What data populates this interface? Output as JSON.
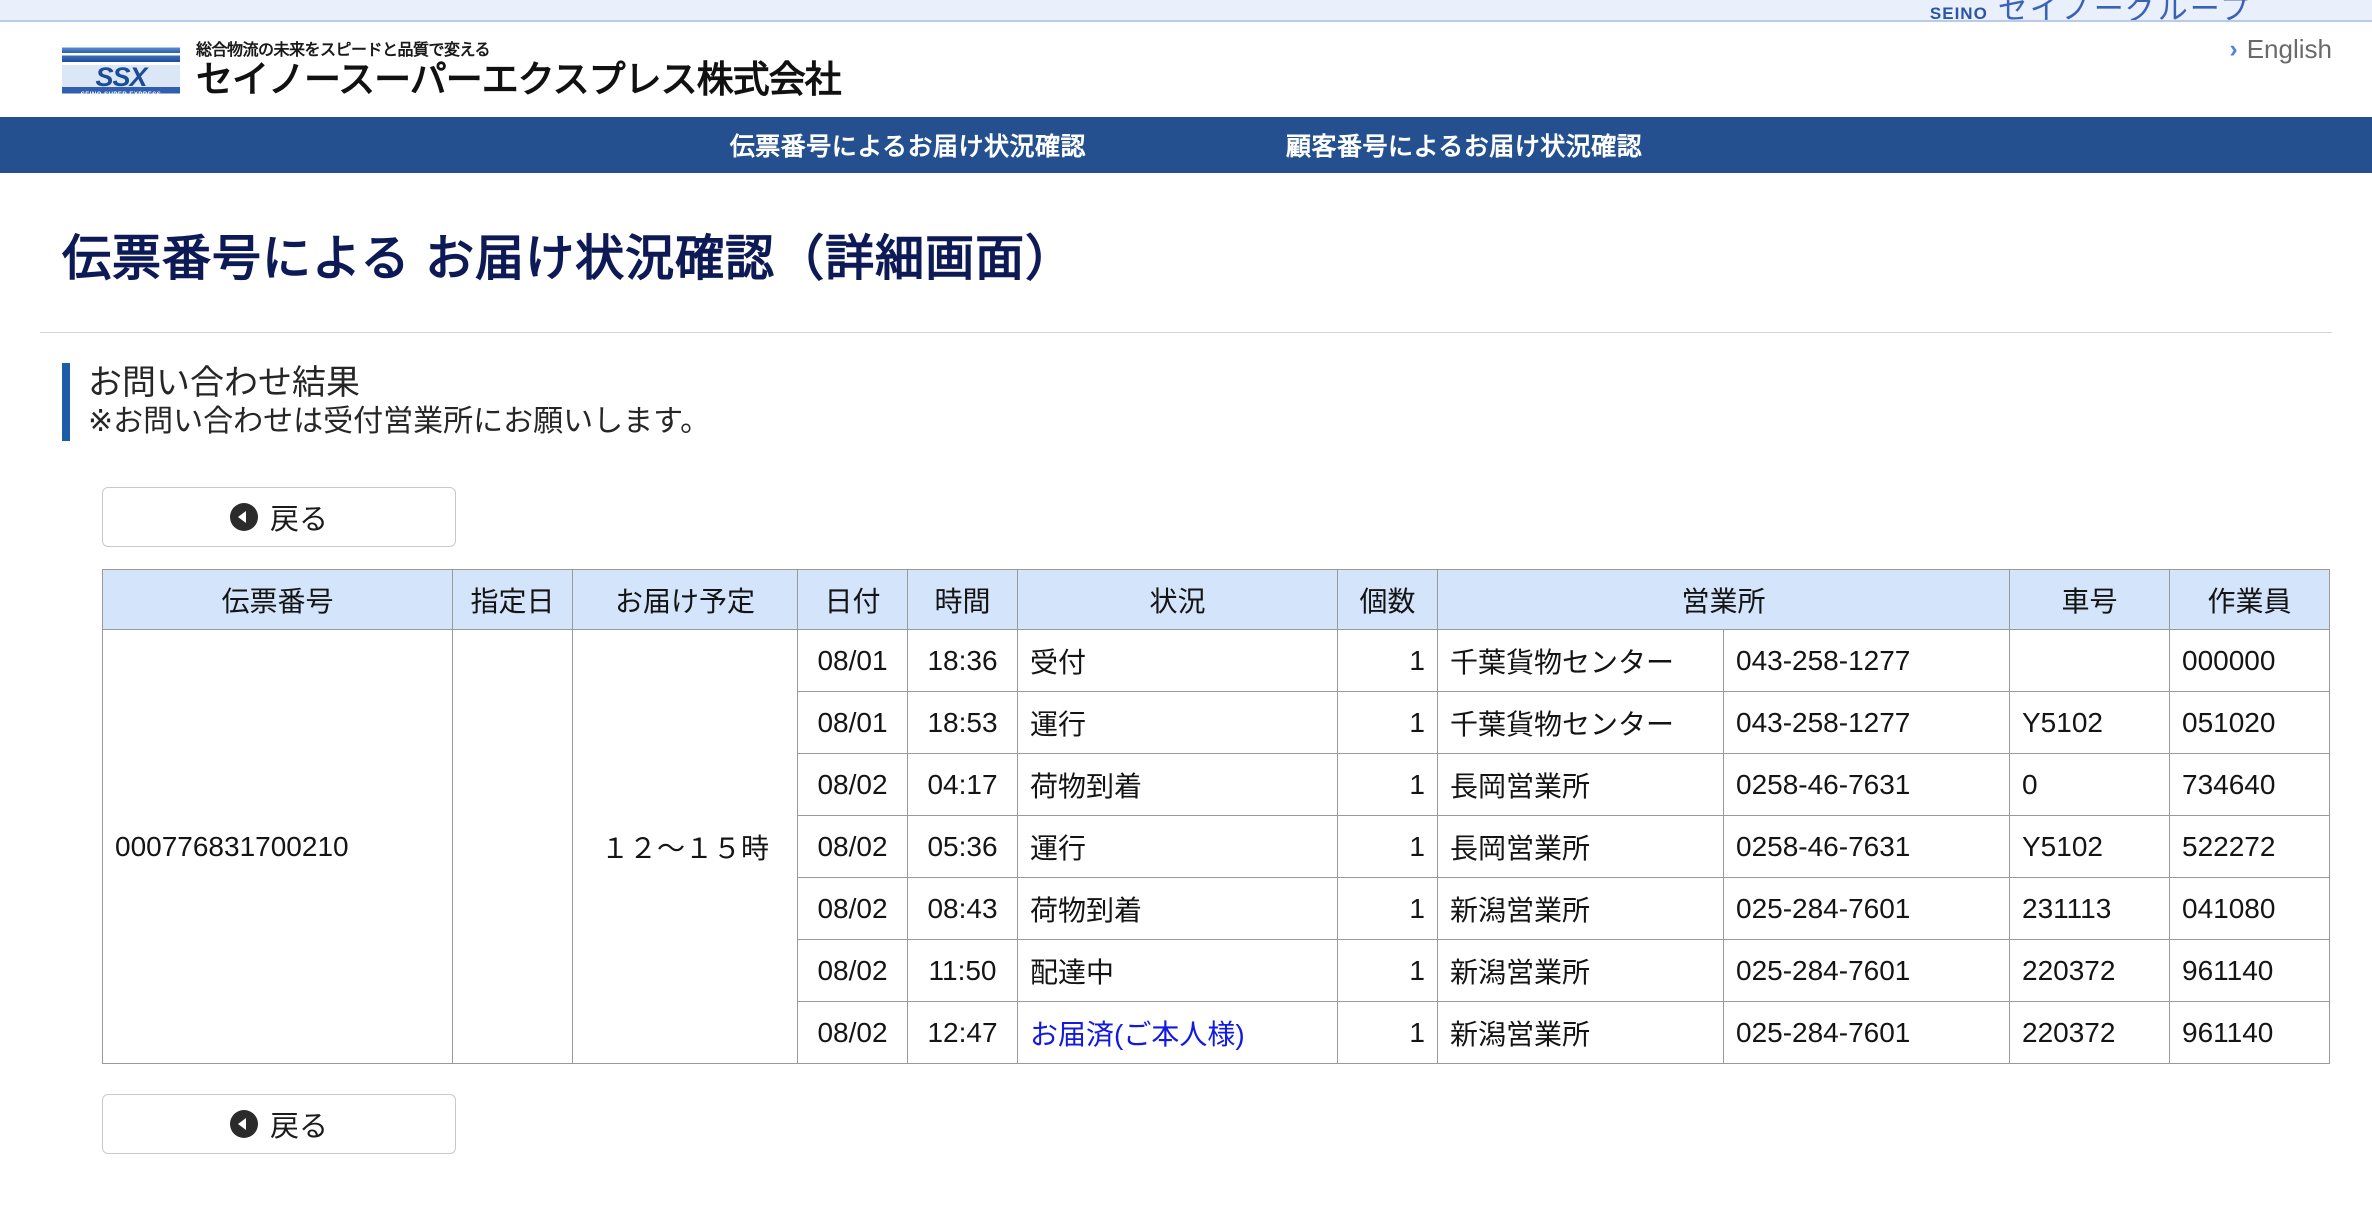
{
  "top_strip": {
    "seino_mark": "SEINO",
    "group_name": "セイノーグループ"
  },
  "header": {
    "logo_mark": "SSX",
    "logo_sub": "SEINO SUPER EXPRESS",
    "brand_tagline": "総合物流の未来をスピードと品質で変える",
    "brand_name": "セイノースーパーエクスプレス株式会社",
    "language_chevron": "›",
    "language_label": "English"
  },
  "nav": {
    "items": [
      {
        "label": "伝票番号によるお届け状況確認"
      },
      {
        "label": "顧客番号によるお届け状況確認"
      }
    ]
  },
  "page": {
    "title": "伝票番号による お届け状況確認（詳細画面）",
    "section_title": "お問い合わせ結果",
    "section_note": "※お問い合わせは受付営業所にお願いします。"
  },
  "buttons": {
    "back_top_label": "戻る",
    "back_bottom_label": "戻る"
  },
  "table": {
    "headers": {
      "slip": "伝票番号",
      "designated_date": "指定日",
      "eta": "お届け予定",
      "date": "日付",
      "time": "時間",
      "status": "状況",
      "quantity": "個数",
      "office": "営業所",
      "truck": "車号",
      "worker": "作業員"
    },
    "shipment": {
      "slip_number": "000776831700210",
      "designated_date": "",
      "eta": "１２～１５時"
    },
    "rows": [
      {
        "date": "08/01",
        "time": "18:36",
        "status": "受付",
        "status_is_link": false,
        "quantity": "1",
        "office": "千葉貨物センター",
        "tel": "043-258-1277",
        "truck": "",
        "worker": "000000"
      },
      {
        "date": "08/01",
        "time": "18:53",
        "status": "運行",
        "status_is_link": false,
        "quantity": "1",
        "office": "千葉貨物センター",
        "tel": "043-258-1277",
        "truck": "Y5102",
        "worker": "051020"
      },
      {
        "date": "08/02",
        "time": "04:17",
        "status": "荷物到着",
        "status_is_link": false,
        "quantity": "1",
        "office": "長岡営業所",
        "tel": "0258-46-7631",
        "truck": "0",
        "worker": "734640"
      },
      {
        "date": "08/02",
        "time": "05:36",
        "status": "運行",
        "status_is_link": false,
        "quantity": "1",
        "office": "長岡営業所",
        "tel": "0258-46-7631",
        "truck": "Y5102",
        "worker": "522272"
      },
      {
        "date": "08/02",
        "time": "08:43",
        "status": "荷物到着",
        "status_is_link": false,
        "quantity": "1",
        "office": "新潟営業所",
        "tel": "025-284-7601",
        "truck": "231113",
        "worker": "041080"
      },
      {
        "date": "08/02",
        "time": "11:50",
        "status": "配達中",
        "status_is_link": false,
        "quantity": "1",
        "office": "新潟営業所",
        "tel": "025-284-7601",
        "truck": "220372",
        "worker": "961140"
      },
      {
        "date": "08/02",
        "time": "12:47",
        "status": "お届済(ご本人様)",
        "status_is_link": true,
        "quantity": "1",
        "office": "新潟営業所",
        "tel": "025-284-7601",
        "truck": "220372",
        "worker": "961140"
      }
    ]
  },
  "colors": {
    "nav_background": "#24508f",
    "table_header_background": "#d4e4fb",
    "accent_bar": "#1d5da8",
    "title_text": "#0d1a55",
    "status_link": "#1219e0",
    "top_strip_background": "#e9f0fb"
  }
}
